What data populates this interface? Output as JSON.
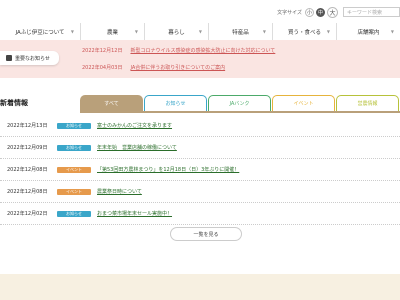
{
  "header": {
    "font_size_label": "文字サイズ",
    "font_sizes": [
      "小",
      "中",
      "大"
    ],
    "search_placeholder": "キーワード検索"
  },
  "nav": {
    "items": [
      "JAふじ伊豆について",
      "農業",
      "暮らし",
      "特産品",
      "買う・食べる",
      "店舗案内"
    ]
  },
  "alert": {
    "button_label": "重要なお知らせ",
    "items": [
      {
        "date": "2022年12月12日",
        "text": "新型コロナウイルス感染症の感染拡大防止に向けた対応について"
      },
      {
        "date": "2022年04月03日",
        "text": "JA合併に伴うお取り引きについてのご案内"
      }
    ]
  },
  "news": {
    "section_title": "新着情報",
    "tabs": [
      {
        "label": "すべて",
        "color": "#b9a07a",
        "active": true
      },
      {
        "label": "お知らせ",
        "color": "#3aa6c9",
        "active": false
      },
      {
        "label": "JAバンク",
        "color": "#4caa6a",
        "active": false
      },
      {
        "label": "イベント",
        "color": "#e6b43c",
        "active": false
      },
      {
        "label": "営農情報",
        "color": "#b7c23a",
        "active": false
      }
    ],
    "items": [
      {
        "date": "2022年12月13日",
        "category": "お知らせ",
        "category_color": "#3aa6c9",
        "title": "富士のみかんのご注文を承ります"
      },
      {
        "date": "2022年12月09日",
        "category": "お知らせ",
        "category_color": "#3aa6c9",
        "title": "年末年始　営業店舗の稼働について"
      },
      {
        "date": "2022年12月08日",
        "category": "イベント",
        "category_color": "#e69a4c",
        "title": "「第53回田方農林まつり」を12月18日（日）3年ぶりに開催！"
      },
      {
        "date": "2022年12月08日",
        "category": "イベント",
        "category_color": "#e69a4c",
        "title": "農業祭日時について"
      },
      {
        "date": "2022年12月02日",
        "category": "お知らせ",
        "category_color": "#3aa6c9",
        "title": "おまつ菜市場年末セール実施中！"
      }
    ],
    "more_label": "一覧を見る"
  }
}
